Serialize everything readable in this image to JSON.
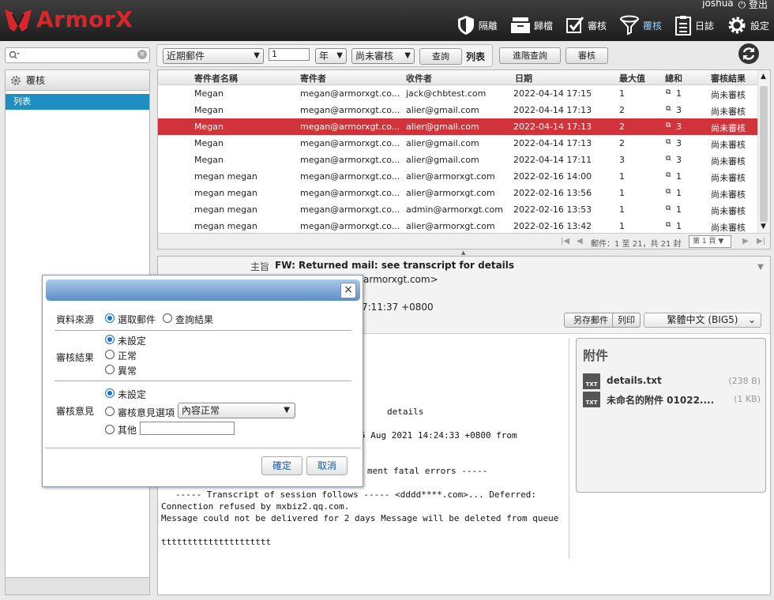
{
  "app": {
    "logo_text": "ArmorX",
    "brand_color": "#d8262c"
  },
  "user": {
    "name": "joshua",
    "logout_label": "登出"
  },
  "nav": [
    {
      "label": "隔離",
      "icon": "shield-icon"
    },
    {
      "label": "歸檔",
      "icon": "archive-icon"
    },
    {
      "label": "審核",
      "icon": "checkbox-icon"
    },
    {
      "label": "覆核",
      "icon": "funnel-icon",
      "active": true
    },
    {
      "label": "日誌",
      "icon": "clipboard-icon"
    },
    {
      "label": "設定",
      "icon": "gear-icon"
    }
  ],
  "toolbar": {
    "period_value": "近期郵件",
    "count_value": "1",
    "unit_value": "年",
    "status_value": "尚未審核",
    "query_label": "查詢",
    "list_label": "列表",
    "advanced_label": "進階查詢",
    "review_label": "審核"
  },
  "sidebar": {
    "title": "覆核",
    "item": "列表"
  },
  "table": {
    "headers": [
      "寄件者名稱",
      "寄件者",
      "收件者",
      "日期",
      "最大值",
      "總和",
      "審核結果"
    ],
    "rows": [
      {
        "name": "Megan",
        "from": "megan@armorxgt.co...",
        "to": "jack@chbtest.com",
        "date": "2022-04-14 17:15",
        "max": "1",
        "sum": "1",
        "result": "尚未審核"
      },
      {
        "name": "Megan",
        "from": "megan@armorxgt.co...",
        "to": "alier@gmail.com",
        "date": "2022-04-14 17:13",
        "max": "2",
        "sum": "3",
        "result": "尚未審核"
      },
      {
        "name": "Megan",
        "from": "megan@armorxgt.co...",
        "to": "alier@gmail.com",
        "date": "2022-04-14 17:13",
        "max": "2",
        "sum": "3",
        "result": "尚未審核",
        "selected": true
      },
      {
        "name": "Megan",
        "from": "megan@armorxgt.co...",
        "to": "alier@gmail.com",
        "date": "2022-04-14 17:13",
        "max": "2",
        "sum": "3",
        "result": "尚未審核"
      },
      {
        "name": "Megan",
        "from": "megan@armorxgt.co...",
        "to": "alier@gmail.com",
        "date": "2022-04-14 17:11",
        "max": "3",
        "sum": "3",
        "result": "尚未審核"
      },
      {
        "name": "megan megan",
        "from": "megan@armorxgt.co...",
        "to": "alier@armorxgt.com",
        "date": "2022-02-16 14:00",
        "max": "1",
        "sum": "1",
        "result": "尚未審核"
      },
      {
        "name": "megan megan",
        "from": "megan@armorxgt.co...",
        "to": "alier@armorxgt.com",
        "date": "2022-02-16 13:56",
        "max": "1",
        "sum": "1",
        "result": "尚未審核"
      },
      {
        "name": "megan megan",
        "from": "megan@armorxgt.co...",
        "to": "admin@armorxgt.com",
        "date": "2022-02-16 13:53",
        "max": "1",
        "sum": "1",
        "result": "尚未審核"
      },
      {
        "name": "megan megan",
        "from": "megan@armorxgt.co...",
        "to": "alier@armorxgt.com",
        "date": "2022-02-16 13:42",
        "max": "1",
        "sum": "1",
        "result": "尚未審核"
      }
    ],
    "pager_text": "郵件：1 至 21，共 21 封",
    "page_value": "第 1 頁"
  },
  "preview": {
    "subject_label": "主旨",
    "subject": "FW: Returned mail: see transcript for details",
    "from_fragment": "armorxgt.com>",
    "date_fragment": "7:11:37 +0800",
    "save_label": "另存郵件",
    "print_label": "列印",
    "encoding_value": "繁體中文 (BIG5)",
    "body_lines": [
      "details",
      "5 Aug 2021 14:24:33 +0800 from",
      "ment fatal errors -----",
      "----- Transcript of session follows ----- <dddd****.com>... Deferred:",
      "Connection refused by mxbiz2.qq.com.",
      "Message could not be delivered for 2 days Message will be deleted from queue",
      "ttttttttttttttttttttt"
    ]
  },
  "attachments": {
    "title": "附件",
    "files": [
      {
        "name": "details.txt",
        "size": "(238 B)",
        "icon_label": "TXT"
      },
      {
        "name": "未命名的附件 01022....",
        "size": "(1 KB)",
        "icon_label": "TXT"
      }
    ]
  },
  "dialog": {
    "source_label": "資料來源",
    "source_opt1": "選取郵件",
    "source_opt2": "查詢結果",
    "result_label": "審核結果",
    "result_opt1": "未設定",
    "result_opt2": "正常",
    "result_opt3": "異常",
    "opinion_label": "審核意見",
    "opinion_opt1": "未設定",
    "opinion_opt2": "審核意見選項",
    "opinion_select": "內容正常",
    "opinion_opt3": "其他",
    "ok_label": "確定",
    "cancel_label": "取消"
  }
}
